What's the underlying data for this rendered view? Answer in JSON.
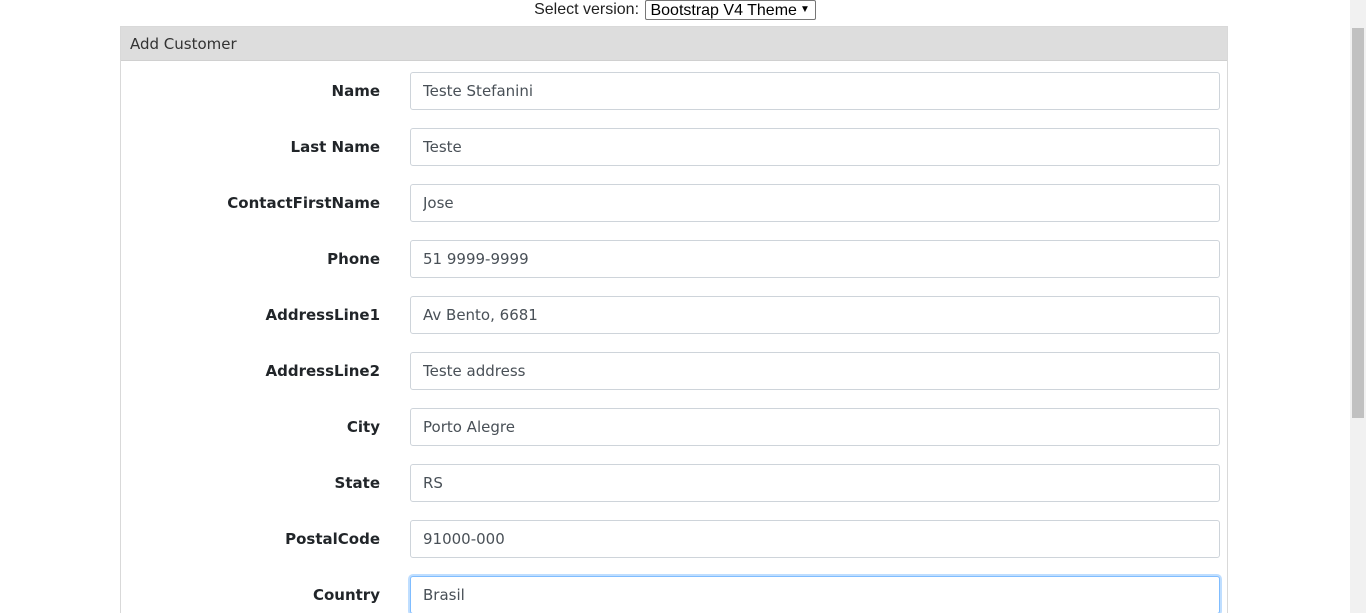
{
  "version_bar": {
    "label": "Select version:",
    "selected": "Bootstrap V4 Theme"
  },
  "card": {
    "title": "Add Customer"
  },
  "form": {
    "fields": [
      {
        "label": "Name",
        "value": "Teste Stefanini"
      },
      {
        "label": "Last Name",
        "value": "Teste"
      },
      {
        "label": "ContactFirstName",
        "value": "Jose"
      },
      {
        "label": "Phone",
        "value": "51 9999-9999"
      },
      {
        "label": "AddressLine1",
        "value": "Av Bento, 6681"
      },
      {
        "label": "AddressLine2",
        "value": "Teste address"
      },
      {
        "label": "City",
        "value": "Porto Alegre"
      },
      {
        "label": "State",
        "value": "RS"
      },
      {
        "label": "PostalCode",
        "value": "91000-000"
      },
      {
        "label": "Country",
        "value": "Brasil"
      }
    ]
  },
  "colors": {
    "header_bg": "#dddddd",
    "input_border": "#ced4da",
    "focus_border": "#80bdff"
  }
}
